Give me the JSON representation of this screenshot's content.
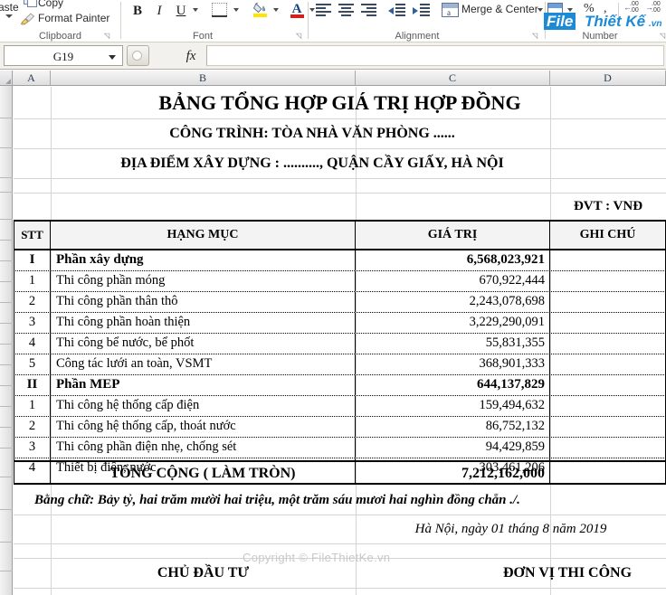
{
  "ribbon": {
    "groups": [
      {
        "name": "Clipboard",
        "label": "Clipboard"
      },
      {
        "name": "Font",
        "label": "Font"
      },
      {
        "name": "Alignment",
        "label": "Alignment"
      },
      {
        "name": "Number",
        "label": "Number"
      }
    ],
    "clipboard": {
      "paste_label": "aste",
      "copy_label": "Copy",
      "format_painter_label": "Format Painter"
    },
    "font": {
      "bold_label": "B",
      "italic_label": "I",
      "underline_label": "U",
      "font_color_label": "A"
    },
    "alignment": {
      "merge_center_label": "Merge & Center",
      "merge_icon_letter": "a"
    },
    "number": {
      "percent_label": "%",
      "comma_label": ",",
      "decimal_top": ".00",
      "decimal_bottom": ".00"
    },
    "logo": {
      "file_text": "File",
      "thietke_text": "Thiết Kế",
      "vn_text": ".vn"
    }
  },
  "formula_bar": {
    "name_box_value": "G19",
    "fx_label": "fx",
    "formula_value": ""
  },
  "grid": {
    "column_headers": [
      "A",
      "B",
      "C",
      "D"
    ]
  },
  "sheet": {
    "title": "BẢNG TỔNG HỢP GIÁ TRỊ HỢP ĐỒNG",
    "subtitle1": "CÔNG TRÌNH: TÒA NHÀ VĂN PHÒNG ......",
    "subtitle2": "ĐỊA ĐIỂM XÂY DỰNG : .........., QUẬN CẦY GIẤY, HÀ NỘI",
    "unit_note": "ĐVT : VNĐ",
    "table_headers": {
      "stt": "STT",
      "item": "HẠNG MỤC",
      "value": "GIÁ TRỊ",
      "note": "GHI CHÚ"
    },
    "rows": [
      {
        "stt": "I",
        "item": "Phần xây dựng",
        "value": "6,568,023,921",
        "note": "",
        "bold": true
      },
      {
        "stt": "1",
        "item": "Thi công phần móng",
        "value": "670,922,444",
        "note": "",
        "bold": false
      },
      {
        "stt": "2",
        "item": "Thi công phần thân thô",
        "value": "2,243,078,698",
        "note": "",
        "bold": false
      },
      {
        "stt": "3",
        "item": "Thi công phần hoàn thiện",
        "value": "3,229,290,091",
        "note": "",
        "bold": false
      },
      {
        "stt": "4",
        "item": "Thi công bể nước, bể phốt",
        "value": "55,831,355",
        "note": "",
        "bold": false
      },
      {
        "stt": "5",
        "item": "Công tác lưới an toàn, VSMT",
        "value": "368,901,333",
        "note": "",
        "bold": false
      },
      {
        "stt": "II",
        "item": "Phần MEP",
        "value": "644,137,829",
        "note": "",
        "bold": true
      },
      {
        "stt": "1",
        "item": "Thi công hệ thống cấp điện",
        "value": "159,494,632",
        "note": "",
        "bold": false
      },
      {
        "stt": "2",
        "item": "Thi công hệ thống cấp, thoát nước",
        "value": "86,752,132",
        "note": "",
        "bold": false
      },
      {
        "stt": "3",
        "item": "Thi công phần điện nhẹ, chống sét",
        "value": "94,429,859",
        "note": "",
        "bold": false
      },
      {
        "stt": "4",
        "item": "Thiết bị điện, nước",
        "value": "303,461,206",
        "note": "",
        "bold": false
      }
    ],
    "total_label": "TỔNG CỘNG ( LÀM TRÒN)",
    "total_value": "7,212,162,000",
    "amount_in_words": "Bằng chữ: Bảy tỷ, hai trăm mười hai triệu, một trăm sáu mươi hai nghìn đồng chẵn ./.",
    "date_line": "Hà Nội, ngày 01 tháng 8 năm 2019",
    "signature_left": "CHỦ ĐẦU TƯ",
    "signature_right": "ĐƠN VỊ THI CÔNG"
  },
  "watermark": {
    "copyright_text": "Copyright © FileThietKe.vn"
  }
}
